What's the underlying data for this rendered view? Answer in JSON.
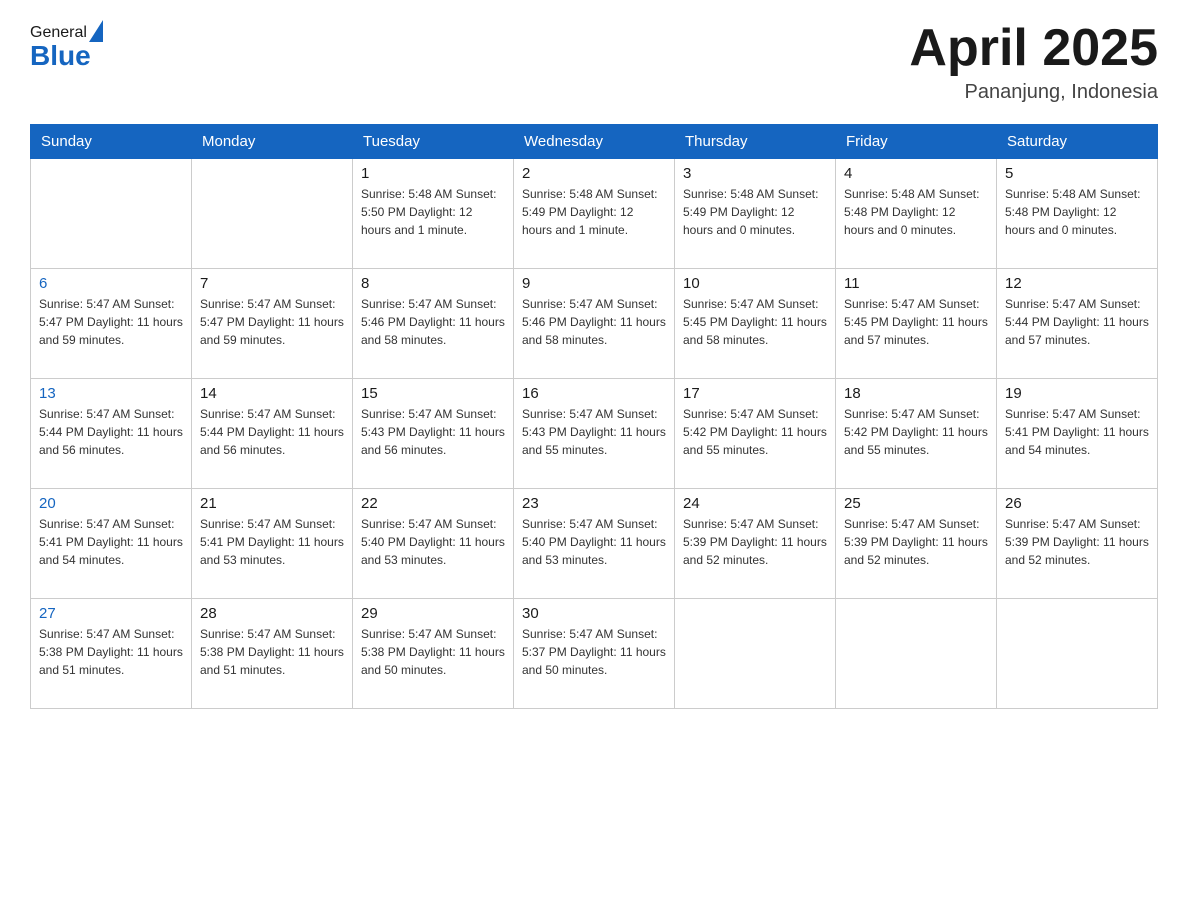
{
  "header": {
    "logo_general": "General",
    "logo_blue": "Blue",
    "month_title": "April 2025",
    "location": "Pananjung, Indonesia"
  },
  "days_of_week": [
    "Sunday",
    "Monday",
    "Tuesday",
    "Wednesday",
    "Thursday",
    "Friday",
    "Saturday"
  ],
  "weeks": [
    [
      {
        "day": "",
        "info": ""
      },
      {
        "day": "",
        "info": ""
      },
      {
        "day": "1",
        "info": "Sunrise: 5:48 AM\nSunset: 5:50 PM\nDaylight: 12 hours\nand 1 minute."
      },
      {
        "day": "2",
        "info": "Sunrise: 5:48 AM\nSunset: 5:49 PM\nDaylight: 12 hours\nand 1 minute."
      },
      {
        "day": "3",
        "info": "Sunrise: 5:48 AM\nSunset: 5:49 PM\nDaylight: 12 hours\nand 0 minutes."
      },
      {
        "day": "4",
        "info": "Sunrise: 5:48 AM\nSunset: 5:48 PM\nDaylight: 12 hours\nand 0 minutes."
      },
      {
        "day": "5",
        "info": "Sunrise: 5:48 AM\nSunset: 5:48 PM\nDaylight: 12 hours\nand 0 minutes."
      }
    ],
    [
      {
        "day": "6",
        "info": "Sunrise: 5:47 AM\nSunset: 5:47 PM\nDaylight: 11 hours\nand 59 minutes."
      },
      {
        "day": "7",
        "info": "Sunrise: 5:47 AM\nSunset: 5:47 PM\nDaylight: 11 hours\nand 59 minutes."
      },
      {
        "day": "8",
        "info": "Sunrise: 5:47 AM\nSunset: 5:46 PM\nDaylight: 11 hours\nand 58 minutes."
      },
      {
        "day": "9",
        "info": "Sunrise: 5:47 AM\nSunset: 5:46 PM\nDaylight: 11 hours\nand 58 minutes."
      },
      {
        "day": "10",
        "info": "Sunrise: 5:47 AM\nSunset: 5:45 PM\nDaylight: 11 hours\nand 58 minutes."
      },
      {
        "day": "11",
        "info": "Sunrise: 5:47 AM\nSunset: 5:45 PM\nDaylight: 11 hours\nand 57 minutes."
      },
      {
        "day": "12",
        "info": "Sunrise: 5:47 AM\nSunset: 5:44 PM\nDaylight: 11 hours\nand 57 minutes."
      }
    ],
    [
      {
        "day": "13",
        "info": "Sunrise: 5:47 AM\nSunset: 5:44 PM\nDaylight: 11 hours\nand 56 minutes."
      },
      {
        "day": "14",
        "info": "Sunrise: 5:47 AM\nSunset: 5:44 PM\nDaylight: 11 hours\nand 56 minutes."
      },
      {
        "day": "15",
        "info": "Sunrise: 5:47 AM\nSunset: 5:43 PM\nDaylight: 11 hours\nand 56 minutes."
      },
      {
        "day": "16",
        "info": "Sunrise: 5:47 AM\nSunset: 5:43 PM\nDaylight: 11 hours\nand 55 minutes."
      },
      {
        "day": "17",
        "info": "Sunrise: 5:47 AM\nSunset: 5:42 PM\nDaylight: 11 hours\nand 55 minutes."
      },
      {
        "day": "18",
        "info": "Sunrise: 5:47 AM\nSunset: 5:42 PM\nDaylight: 11 hours\nand 55 minutes."
      },
      {
        "day": "19",
        "info": "Sunrise: 5:47 AM\nSunset: 5:41 PM\nDaylight: 11 hours\nand 54 minutes."
      }
    ],
    [
      {
        "day": "20",
        "info": "Sunrise: 5:47 AM\nSunset: 5:41 PM\nDaylight: 11 hours\nand 54 minutes."
      },
      {
        "day": "21",
        "info": "Sunrise: 5:47 AM\nSunset: 5:41 PM\nDaylight: 11 hours\nand 53 minutes."
      },
      {
        "day": "22",
        "info": "Sunrise: 5:47 AM\nSunset: 5:40 PM\nDaylight: 11 hours\nand 53 minutes."
      },
      {
        "day": "23",
        "info": "Sunrise: 5:47 AM\nSunset: 5:40 PM\nDaylight: 11 hours\nand 53 minutes."
      },
      {
        "day": "24",
        "info": "Sunrise: 5:47 AM\nSunset: 5:39 PM\nDaylight: 11 hours\nand 52 minutes."
      },
      {
        "day": "25",
        "info": "Sunrise: 5:47 AM\nSunset: 5:39 PM\nDaylight: 11 hours\nand 52 minutes."
      },
      {
        "day": "26",
        "info": "Sunrise: 5:47 AM\nSunset: 5:39 PM\nDaylight: 11 hours\nand 52 minutes."
      }
    ],
    [
      {
        "day": "27",
        "info": "Sunrise: 5:47 AM\nSunset: 5:38 PM\nDaylight: 11 hours\nand 51 minutes."
      },
      {
        "day": "28",
        "info": "Sunrise: 5:47 AM\nSunset: 5:38 PM\nDaylight: 11 hours\nand 51 minutes."
      },
      {
        "day": "29",
        "info": "Sunrise: 5:47 AM\nSunset: 5:38 PM\nDaylight: 11 hours\nand 50 minutes."
      },
      {
        "day": "30",
        "info": "Sunrise: 5:47 AM\nSunset: 5:37 PM\nDaylight: 11 hours\nand 50 minutes."
      },
      {
        "day": "",
        "info": ""
      },
      {
        "day": "",
        "info": ""
      },
      {
        "day": "",
        "info": ""
      }
    ]
  ]
}
